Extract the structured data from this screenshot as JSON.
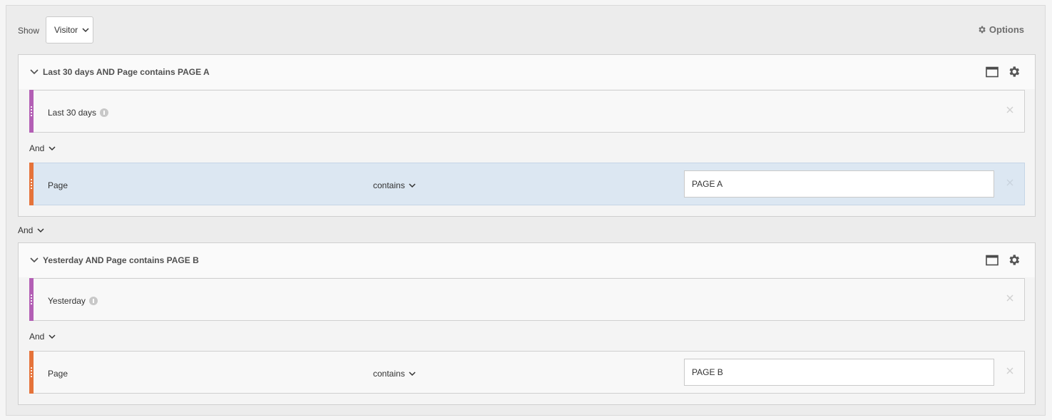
{
  "toolbar": {
    "show_label": "Show",
    "show_value": "Visitor",
    "options_label": "Options"
  },
  "between_containers_conjunction": "And",
  "containers": [
    {
      "title": "Last 30 days AND Page contains PAGE A",
      "rule1": {
        "label": "Last 30 days"
      },
      "conjunction": "And",
      "rule2": {
        "label": "Page",
        "operator": "contains",
        "value": "PAGE A"
      }
    },
    {
      "title": "Yesterday AND Page contains PAGE B",
      "rule1": {
        "label": "Yesterday"
      },
      "conjunction": "And",
      "rule2": {
        "label": "Page",
        "operator": "contains",
        "value": "PAGE B"
      }
    }
  ],
  "colors": {
    "date_rule_bar": "#b35fb5",
    "dimension_rule_bar": "#e5733a",
    "highlight_row": "#dce7f2"
  }
}
